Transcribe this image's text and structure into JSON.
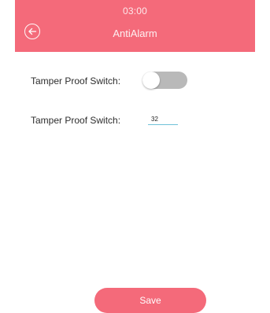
{
  "header": {
    "time": "03:00",
    "title": "AntiAlarm"
  },
  "settings": {
    "tamper_switch_label": "Tamper Proof Switch:",
    "tamper_switch_on": false,
    "tamper_value_label": "Tamper Proof Switch:",
    "tamper_value": "32"
  },
  "actions": {
    "save_label": "Save"
  },
  "colors": {
    "accent": "#f46a7a",
    "toggle_off": "#b9b9b9",
    "input_underline": "#6fc2d8"
  },
  "icons": {
    "back": "back-arrow-circle-icon"
  }
}
